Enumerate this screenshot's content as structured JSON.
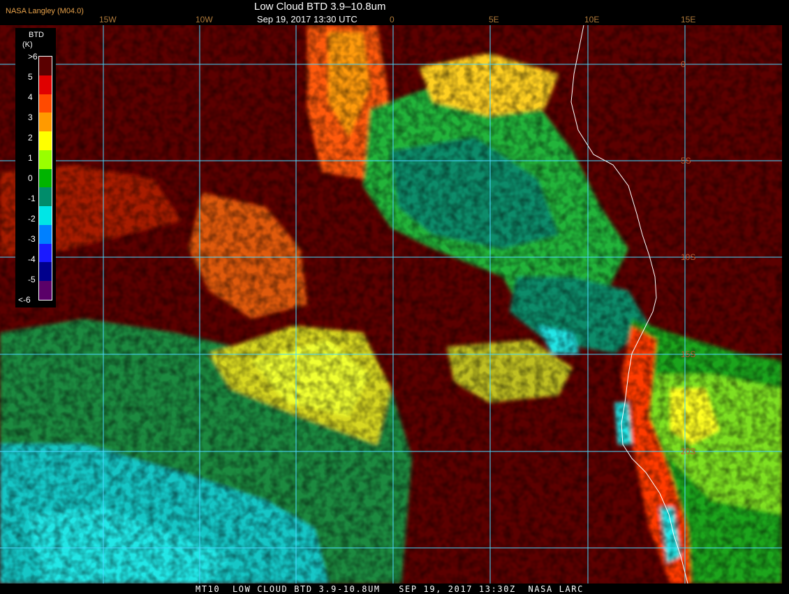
{
  "header": {
    "credit": "NASA Langley (M04.0)",
    "title": "Low Cloud BTD 3.9–10.8um",
    "subtitle": "Sep 19, 2017 13:30 UTC"
  },
  "longitude_labels": [
    "15W",
    "10W",
    "0",
    "5E",
    "10E",
    "15E"
  ],
  "latitude_labels": [
    "0",
    "5S",
    "10S",
    "15S",
    "20S"
  ],
  "legend": {
    "title_line1": "BTD",
    "unit": "(K)",
    "ticks": [
      ">6",
      "5",
      "4",
      "3",
      "2",
      "1",
      "0",
      "-1",
      "-2",
      "-3",
      "-4",
      "-5",
      "<-6"
    ],
    "colors": [
      "#5a0000",
      "#e00000",
      "#ff4a00",
      "#ff9a00",
      "#ffff00",
      "#99ff00",
      "#00b400",
      "#008c6a",
      "#00e6e6",
      "#0080ff",
      "#1a1aff",
      "#00008c",
      "#5a0068"
    ]
  },
  "footer": {
    "text": "MT10  LOW CLOUD BTD 3.9-10.8UM   SEP 19, 2017 13:30Z  NASA LARC"
  },
  "colors": {
    "background": "#5c0000",
    "grid": "#4ad8ff",
    "coast": "#ffffff"
  }
}
